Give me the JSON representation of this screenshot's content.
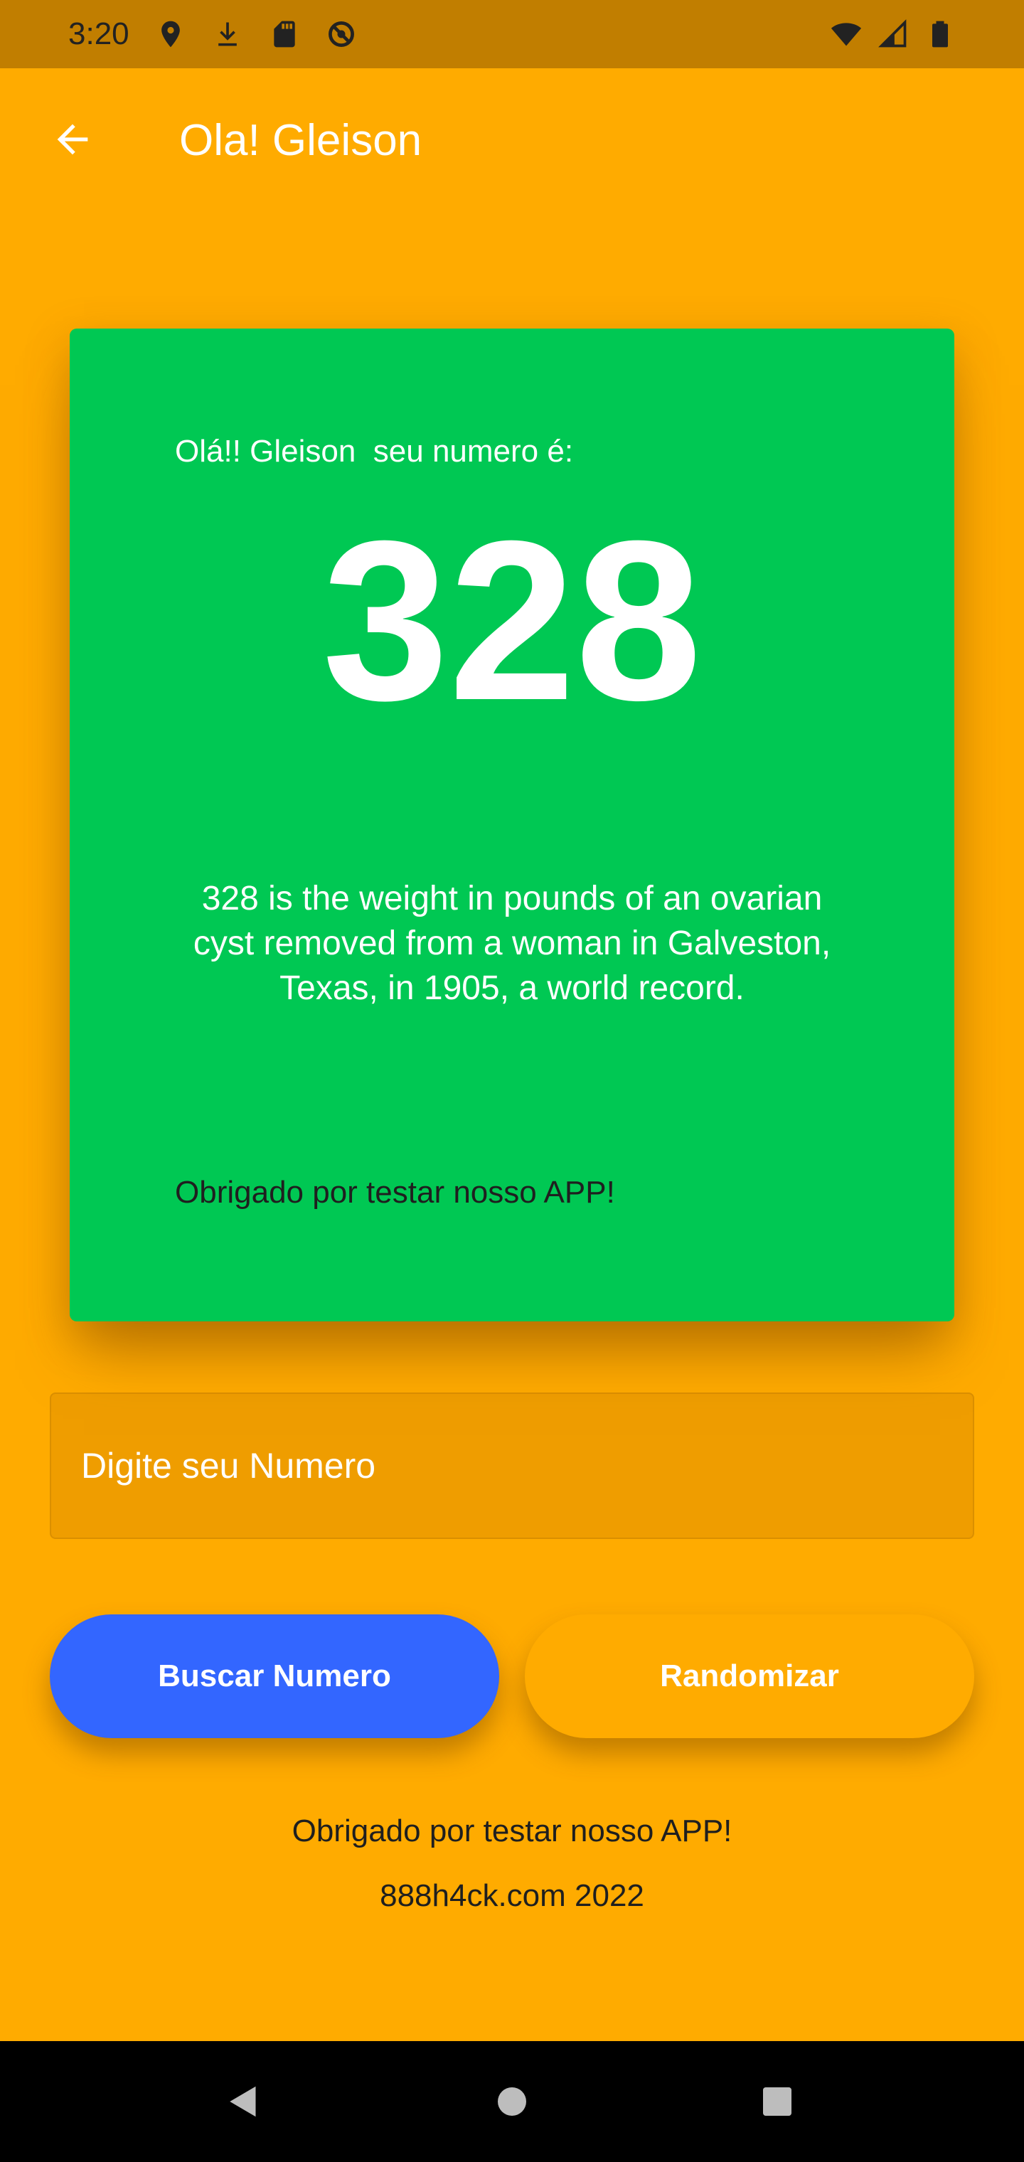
{
  "status_bar": {
    "time": "3:20",
    "left_icons": [
      "location-icon",
      "download-icon",
      "sd-card-icon",
      "sync-disabled-icon"
    ],
    "right_icons": [
      "wifi-icon",
      "cell-signal-icon",
      "battery-icon"
    ]
  },
  "app_bar": {
    "back_icon": "arrow-back-icon",
    "title": "Ola! Gleison"
  },
  "card": {
    "background": "#00C853",
    "greeting": "Olá!! Gleison  seu numero é:",
    "number": "328",
    "fact": "328 is the weight in pounds of an ovarian cyst removed from a woman in Galveston, Texas, in 1905, a world record.",
    "thanks": "Obrigado por testar nosso APP!"
  },
  "input": {
    "placeholder": "Digite seu Numero",
    "value": ""
  },
  "buttons": {
    "search_label": "Buscar Numero",
    "search_color": "#3366FF",
    "random_label": "Randomizar",
    "random_color": "#FFAB00"
  },
  "footer": {
    "thanks": "Obrigado por testar nosso APP!",
    "site": "888h4ck.com 2022"
  },
  "nav_bar": {
    "icons": [
      "nav-back-icon",
      "nav-home-icon",
      "nav-recents-icon"
    ]
  },
  "theme": {
    "background": "#FFAB00",
    "status_bar": "#C17E00"
  }
}
